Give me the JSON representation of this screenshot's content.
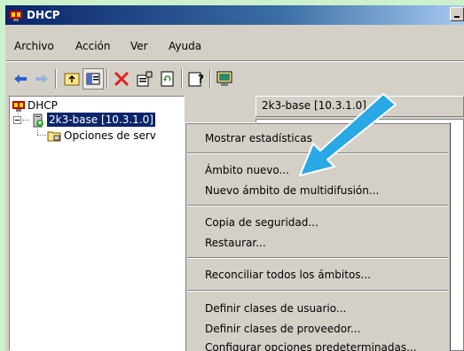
{
  "window": {
    "title": "DHCP"
  },
  "menubar": {
    "items": [
      "Archivo",
      "Acción",
      "Ver",
      "Ayuda"
    ]
  },
  "toolbar": {
    "buttons": [
      "back-icon",
      "forward-icon",
      "up-folder-icon",
      "show-hide-tree-icon",
      "delete-icon",
      "properties-icon",
      "refresh-icon",
      "help-icon",
      "console-icon"
    ],
    "colors": {
      "delete": "#e02020",
      "forward": "#7aa0e0",
      "back": "#3060d0"
    }
  },
  "tree": {
    "root": "DHCP",
    "server": "2k3-base [10.3.1.0]",
    "child": "Opciones de serv"
  },
  "right_panel": {
    "header": "2k3-base [10.3.1.0]"
  },
  "context_menu": {
    "groups": [
      [
        "Mostrar estadísticas"
      ],
      [
        "Ámbito nuevo...",
        "Nuevo ámbito de multidifusión..."
      ],
      [
        "Copia de seguridad...",
        "Restaurar..."
      ],
      [
        "Reconciliar todos los ámbitos..."
      ],
      [
        "Definir clases de usuario...",
        "Definir clases de proveedor...",
        "Configurar opciones predeterminadas..."
      ]
    ]
  },
  "accent": {
    "selection": "#0a246a",
    "arrow": "#29a8e6"
  }
}
